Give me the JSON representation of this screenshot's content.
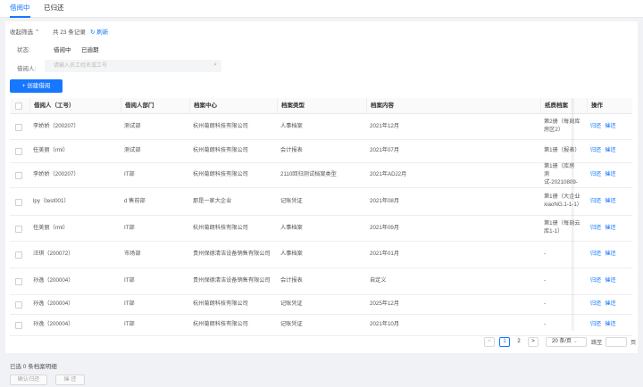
{
  "tabs": [
    {
      "label": "借阅中",
      "active": true
    },
    {
      "label": "已归还",
      "active": false
    }
  ],
  "filters": {
    "toggle_label": "收起筛选",
    "count_text": "共 23 条记录",
    "refresh_label": "刷新",
    "status_label": "状态:",
    "status_options": [
      "借阅中",
      "已逾期"
    ],
    "borrower_label": "借阅人:",
    "borrower_placeholder": "请输入员工姓名或工号"
  },
  "create_button": "+ 创建借阅",
  "table": {
    "columns": [
      "借阅人（工号）",
      "借阅人部门",
      "档案中心",
      "档案类型",
      "档案内容",
      "纸质档案",
      "操作"
    ],
    "rows": [
      {
        "borrower": "李娇娇（200207）",
        "dept": "测试部",
        "center": "杭州菊朗科技有限公司",
        "type": "人事档案",
        "content": "2021年12月",
        "paper": "第2册（每刻库房区2）"
      },
      {
        "borrower": "任美丽（rml）",
        "dept": "测试部",
        "center": "杭州菊朗科技有限公司",
        "type": "会计报表",
        "content": "2021年07月",
        "paper": "第1册（报表）"
      },
      {
        "borrower": "李娇娇（200207）",
        "dept": "IT部",
        "center": "杭州菊朗科技有限公司",
        "type": "2110回归测试档案类型",
        "content": "2021年ADJ2月",
        "paper": "第1册（库房 测试-20210809-"
      },
      {
        "borrower": "lpy（test001）",
        "dept": "d 售前部",
        "center": "那是一家大企业",
        "type": "记账凭证",
        "content": "2021年08月",
        "paper": "第1册（大企业xiaoNG.1-1-1）"
      },
      {
        "borrower": "任美丽（rml）",
        "dept": "IT部",
        "center": "杭州菊朗科技有限公司",
        "type": "人事档案",
        "content": "2021年09月",
        "paper": "第1册（每刻云库1-1）"
      },
      {
        "borrower": "汪琪（200072）",
        "dept": "市场部",
        "center": "贵州保德清洁设备销售有限公司",
        "type": "人事档案",
        "content": "2021年01月",
        "paper": "-"
      },
      {
        "borrower": "孙逸（200004）",
        "dept": "IT部",
        "center": "贵州保德清洁设备销售有限公司",
        "type": "会计报表",
        "content": "自定义",
        "paper": "-"
      },
      {
        "borrower": "孙逸（200004）",
        "dept": "IT部",
        "center": "杭州菊朗科技有限公司",
        "type": "记账凭证",
        "content": "2025年12月",
        "paper": "-"
      },
      {
        "borrower": "孙逸（200004）",
        "dept": "IT部",
        "center": "杭州菊朗科技有限公司",
        "type": "记账凭证",
        "content": "2021年10月",
        "paper": "-"
      }
    ],
    "actions": [
      "归还",
      "催还"
    ]
  },
  "pagination": {
    "prev": "<",
    "pages": [
      "1",
      "2"
    ],
    "current": "1",
    "next": ">",
    "page_size": "20 条/页",
    "jump_label": "跳至",
    "jump_unit": "页"
  },
  "footer": {
    "selected_text": "已选 0 条档案明细",
    "confirm_button": "确认归还",
    "remind_button": "催 还"
  },
  "colors": {
    "accent": "#1677ff"
  }
}
